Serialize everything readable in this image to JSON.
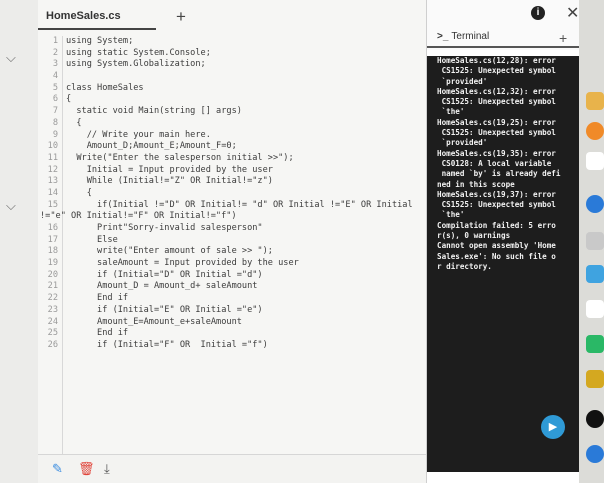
{
  "editor": {
    "tab_title": "HomeSales.cs",
    "add_tab_symbol": "+",
    "lines": [
      {
        "num": "1",
        "text": "using System;"
      },
      {
        "num": "2",
        "text": "using static System.Console;"
      },
      {
        "num": "3",
        "text": "using System.Globalization;"
      },
      {
        "num": "4",
        "text": ""
      },
      {
        "num": "5",
        "text": "class HomeSales"
      },
      {
        "num": "6",
        "text": "{"
      },
      {
        "num": "7",
        "text": "  static void Main(string [] args)"
      },
      {
        "num": "8",
        "text": "  {"
      },
      {
        "num": "9",
        "text": "    // Write your main here."
      },
      {
        "num": "10",
        "text": "    Amount_D;Amount_E;Amount_F=0;"
      },
      {
        "num": "11",
        "text": "  Write(\"Enter the salesperson initial >>\");"
      },
      {
        "num": "12",
        "text": "    Initial = Input provided by the user"
      },
      {
        "num": "13",
        "text": "    While (Initial!=\"Z\" OR Initial!=\"z\")"
      },
      {
        "num": "14",
        "text": "    {"
      },
      {
        "num": "15",
        "text": "      if(Initial !=\"D\" OR Initial!= \"d\" OR Initial !=\"E\" OR Initial"
      },
      {
        "num": "",
        "text": "!=\"e\" OR Initial!=\"F\" OR Initial!=\"f\")"
      },
      {
        "num": "16",
        "text": "      Print\"Sorry-invalid salesperson\""
      },
      {
        "num": "17",
        "text": "      Else"
      },
      {
        "num": "18",
        "text": "      write(\"Enter amount of sale >> \");"
      },
      {
        "num": "19",
        "text": "      saleAmount = Input provided by the user"
      },
      {
        "num": "20",
        "text": "      if (Initial=\"D\" OR Initial =\"d\")"
      },
      {
        "num": "21",
        "text": "      Amount_D = Amount_d+ saleAmount"
      },
      {
        "num": "22",
        "text": "      End if"
      },
      {
        "num": "23",
        "text": "      if (Initial=\"E\" OR Initial =\"e\")"
      },
      {
        "num": "24",
        "text": "      Amount_E=Amount_e+saleAmount"
      },
      {
        "num": "25",
        "text": "      End if"
      },
      {
        "num": "26",
        "text": "      if (Initial=\"F\" OR  Initial =\"f\")"
      }
    ]
  },
  "terminal": {
    "title": "Terminal",
    "prompt_symbol": ">_",
    "add_symbol": "+",
    "output": [
      "HomeSales.cs(12,28): error",
      " CS1525: Unexpected symbol",
      " `provided'",
      "HomeSales.cs(12,32): error",
      " CS1525: Unexpected symbol",
      " `the'",
      "HomeSales.cs(19,25): error",
      " CS1525: Unexpected symbol",
      " `provided'",
      "HomeSales.cs(19,35): error",
      " CS0128: A local variable",
      " named `by' is already defi",
      "ned in this scope",
      "HomeSales.cs(19,37): error",
      " CS1525: Unexpected symbol",
      " `the'",
      "Compilation failed: 5 erro",
      "r(s), 0 warnings",
      "Cannot open assembly 'Home",
      "Sales.exe': No such file o",
      "r directory."
    ]
  },
  "window": {
    "close_symbol": "✕",
    "info_symbol": "i"
  },
  "bottom_bar": {
    "icons": [
      "pencil-icon",
      "trash-icon",
      "download-icon"
    ]
  },
  "colors": {
    "terminal_bg": "#1d1d1d",
    "editor_bg": "#f6f6f4",
    "play_button": "#2f9ad6"
  }
}
